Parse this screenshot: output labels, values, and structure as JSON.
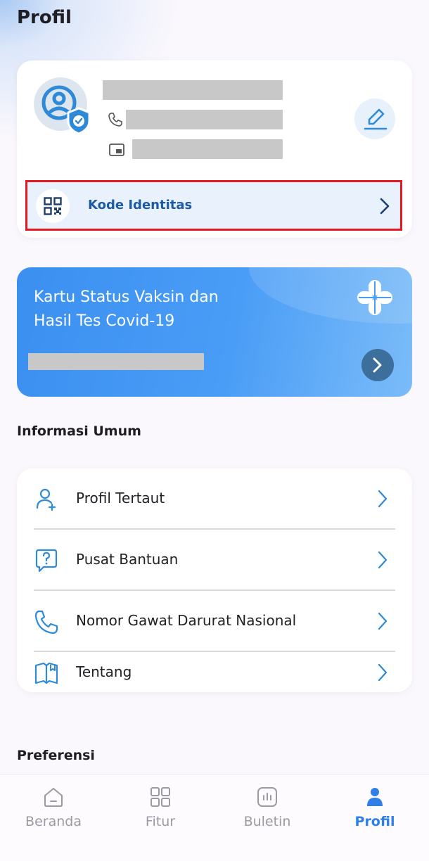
{
  "header": {
    "title": "Profil"
  },
  "profile": {
    "kode_label": "Kode Identitas"
  },
  "vaksin": {
    "title": "Kartu Status Vaksin dan Hasil Tes Covid-19"
  },
  "sections": {
    "info_title": "Informasi Umum",
    "pref_title": "Preferensi"
  },
  "info_items": [
    {
      "label": "Profil Tertaut",
      "icon": "linked-profile-icon"
    },
    {
      "label": "Pusat Bantuan",
      "icon": "help-icon"
    },
    {
      "label": "Nomor Gawat Darurat Nasional",
      "icon": "phone-icon"
    },
    {
      "label": "Tentang",
      "icon": "book-icon"
    }
  ],
  "bottom_nav": [
    {
      "label": "Beranda",
      "icon": "home-icon",
      "active": false
    },
    {
      "label": "Fitur",
      "icon": "grid-icon",
      "active": false
    },
    {
      "label": "Buletin",
      "icon": "news-icon",
      "active": false
    },
    {
      "label": "Profil",
      "icon": "person-icon",
      "active": true
    }
  ],
  "colors": {
    "accent": "#2f7fe6",
    "highlight_border": "#e01b24",
    "card_blue": "#3b8ff0",
    "icon_blue": "#2e8ad8"
  }
}
